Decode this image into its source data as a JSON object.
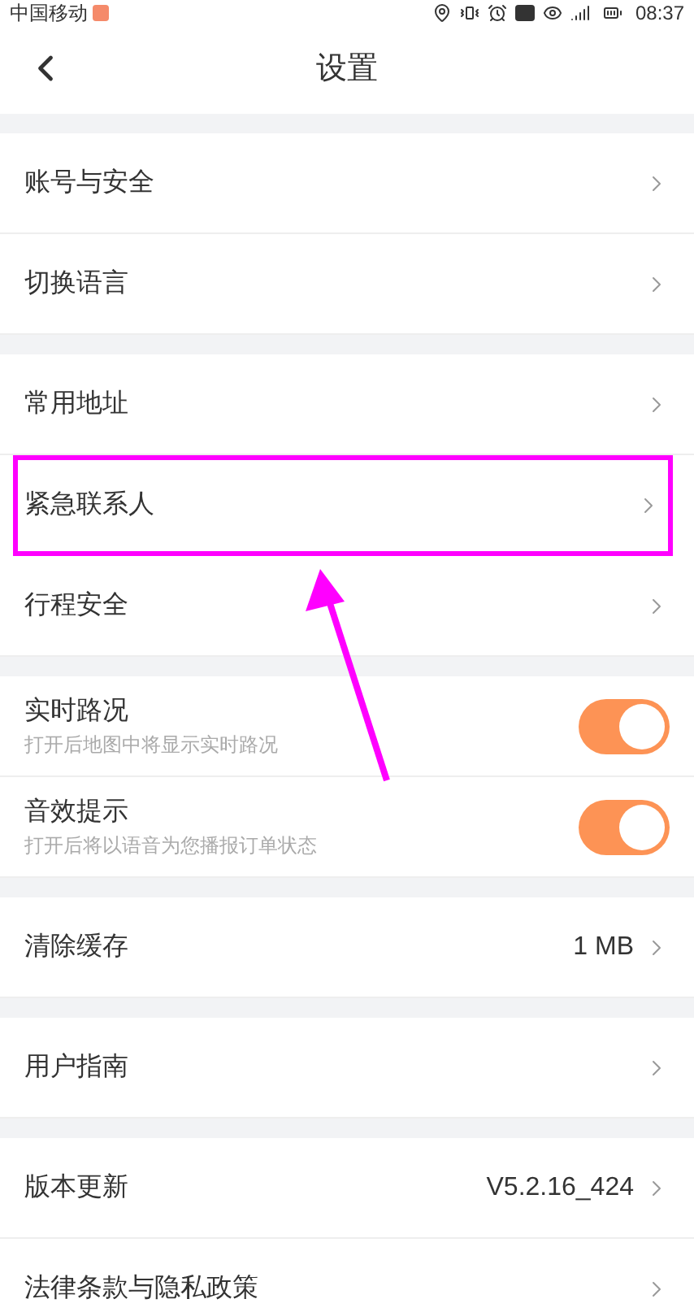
{
  "status_bar": {
    "carrier": "中国移动",
    "time": "08:37"
  },
  "header": {
    "title": "设置"
  },
  "sections": [
    {
      "items": [
        {
          "kind": "link",
          "label": "账号与安全",
          "highlighted": false
        },
        {
          "kind": "link",
          "label": "切换语言",
          "highlighted": false
        }
      ]
    },
    {
      "items": [
        {
          "kind": "link",
          "label": "常用地址",
          "highlighted": false
        },
        {
          "kind": "link",
          "label": "紧急联系人",
          "highlighted": true
        },
        {
          "kind": "link",
          "label": "行程安全",
          "highlighted": false
        }
      ]
    },
    {
      "items": [
        {
          "kind": "toggle",
          "label": "实时路况",
          "subtitle": "打开后地图中将显示实时路况",
          "on": true
        },
        {
          "kind": "toggle",
          "label": "音效提示",
          "subtitle": "打开后将以语音为您播报订单状态",
          "on": true
        }
      ]
    },
    {
      "items": [
        {
          "kind": "link",
          "label": "清除缓存",
          "value": "1 MB",
          "highlighted": false
        }
      ]
    },
    {
      "items": [
        {
          "kind": "link",
          "label": "用户指南",
          "highlighted": false
        }
      ]
    },
    {
      "items": [
        {
          "kind": "link",
          "label": "版本更新",
          "value": "V5.2.16_424",
          "highlighted": false
        },
        {
          "kind": "link",
          "label": "法律条款与隐私政策",
          "highlighted": false
        }
      ]
    }
  ]
}
